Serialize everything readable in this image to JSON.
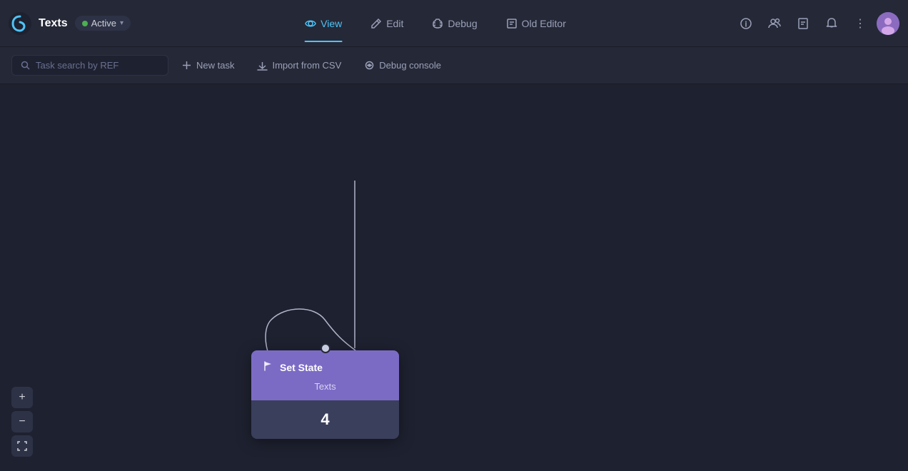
{
  "app": {
    "logo_text": "Texts",
    "status": "Active",
    "status_color": "#4caf50"
  },
  "nav": {
    "view_label": "View",
    "edit_label": "Edit",
    "debug_label": "Debug",
    "old_editor_label": "Old Editor",
    "active_tab": "view"
  },
  "toolbar": {
    "search_placeholder": "Task search by REF",
    "new_task_label": "New task",
    "import_label": "Import from CSV",
    "debug_console_label": "Debug console"
  },
  "node": {
    "type_label": "Set State",
    "name_label": "Texts",
    "count": "4"
  },
  "zoom": {
    "plus_label": "+",
    "minus_label": "−",
    "fit_label": "⛶"
  }
}
